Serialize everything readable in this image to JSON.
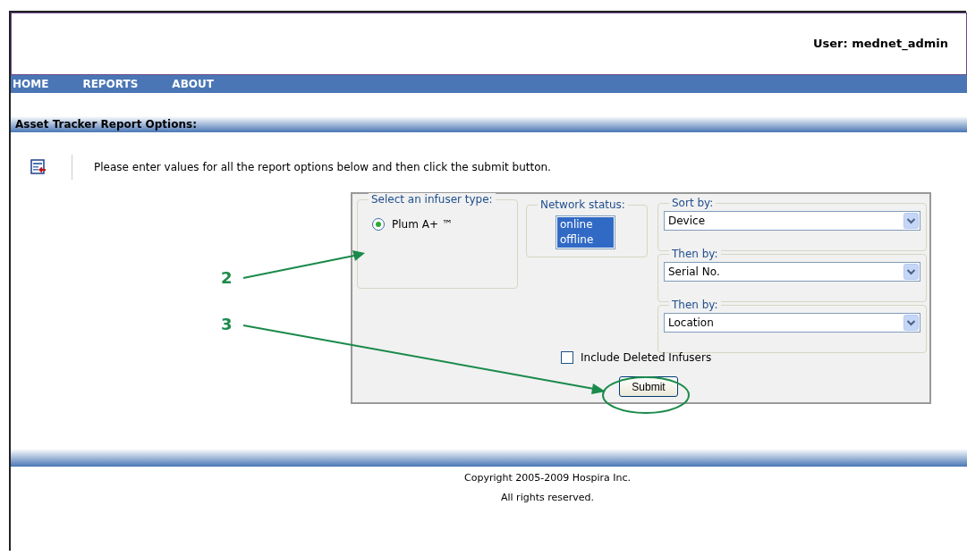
{
  "header": {
    "user_label": "User: mednet_admin"
  },
  "nav": {
    "items": [
      {
        "label": "HOME"
      },
      {
        "label": "REPORTS"
      },
      {
        "label": "ABOUT"
      }
    ]
  },
  "section_title": "Asset Tracker Report Options:",
  "instructions": "Please enter values for all the report options below and then click the submit button.",
  "form": {
    "infuser_type": {
      "legend": "Select an infuser type:",
      "options": [
        {
          "label": "Plum A+ ™",
          "selected": true
        }
      ]
    },
    "network_status": {
      "legend": "Network status:",
      "options": [
        {
          "label": "online",
          "selected": true
        },
        {
          "label": "offline",
          "selected": true
        }
      ]
    },
    "sorts": [
      {
        "legend": "Sort by:",
        "value": "Device"
      },
      {
        "legend": "Then by:",
        "value": "Serial No."
      },
      {
        "legend": "Then by:",
        "value": "Location"
      }
    ],
    "include_deleted": {
      "label": "Include Deleted Infusers",
      "checked": false
    },
    "submit": "Submit"
  },
  "annotations": [
    {
      "label": "2"
    },
    {
      "label": "3"
    }
  ],
  "footer": {
    "lines": [
      "Copyright 2005-2009 Hospira Inc.",
      "All rights reserved."
    ]
  }
}
